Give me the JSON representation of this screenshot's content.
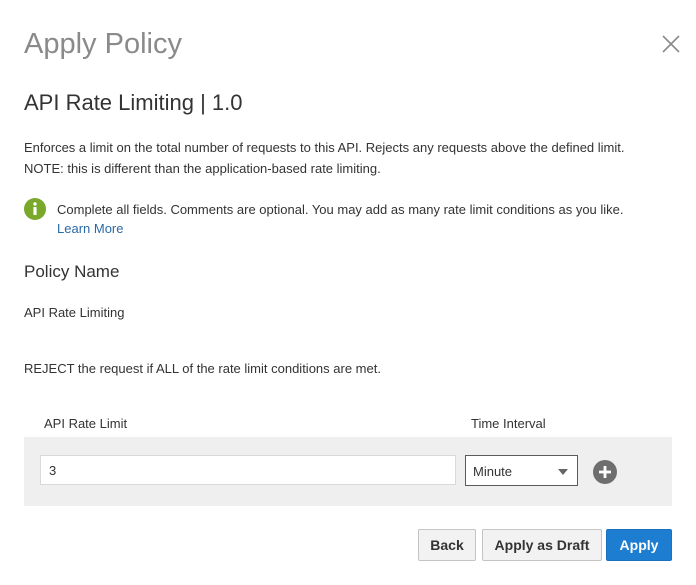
{
  "dialog": {
    "title": "Apply Policy",
    "close_icon": "close-icon"
  },
  "policy": {
    "title": "API Rate Limiting | 1.0",
    "description_line1": "Enforces a limit on the total number of requests to this API. Rejects any requests above the defined limit.",
    "description_line2": "NOTE: this is different than the application-based rate limiting."
  },
  "info": {
    "icon": "info-icon",
    "icon_color": "#79a82a",
    "text": "Complete all fields. Comments are optional. You may add as many rate limit conditions as you like.",
    "learn_more": "Learn More"
  },
  "policy_name": {
    "label": "Policy Name",
    "value": "API Rate Limiting"
  },
  "conditions": {
    "reject_text": "REJECT the request if ALL of the rate limit conditions are met.",
    "col_rate": "API Rate Limit",
    "col_interval": "Time Interval",
    "rows": [
      {
        "rate": "3",
        "interval": "Minute"
      }
    ],
    "add_icon": "plus-circle-icon"
  },
  "buttons": {
    "back": "Back",
    "draft": "Apply as Draft",
    "apply": "Apply"
  },
  "colors": {
    "primary": "#1c7dd1",
    "link": "#2b6aa8",
    "panel": "#efefef"
  }
}
